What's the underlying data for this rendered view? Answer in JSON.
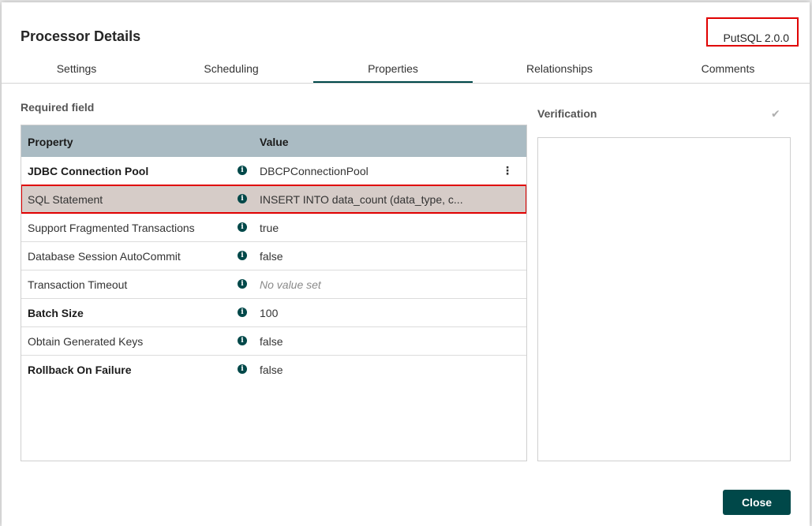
{
  "dialog": {
    "title": "Processor Details",
    "version": "PutSQL 2.0.0"
  },
  "tabs": [
    {
      "label": "Settings"
    },
    {
      "label": "Scheduling"
    },
    {
      "label": "Properties",
      "active": true
    },
    {
      "label": "Relationships"
    },
    {
      "label": "Comments"
    }
  ],
  "properties": {
    "required_label": "Required field",
    "headers": {
      "property": "Property",
      "value": "Value"
    },
    "rows": [
      {
        "name": "JDBC Connection Pool",
        "value": "DBCPConnectionPool",
        "bold": true
      },
      {
        "name": "SQL Statement",
        "value": "INSERT INTO data_count (data_type, c...",
        "selected": true
      },
      {
        "name": "Support Fragmented Transactions",
        "value": "true"
      },
      {
        "name": "Database Session AutoCommit",
        "value": "false"
      },
      {
        "name": "Transaction Timeout",
        "value": "No value set",
        "empty": true
      },
      {
        "name": "Batch Size",
        "value": "100",
        "bold": true
      },
      {
        "name": "Obtain Generated Keys",
        "value": "false"
      },
      {
        "name": "Rollback On Failure",
        "value": "false",
        "bold": true
      }
    ]
  },
  "verification": {
    "label": "Verification",
    "icon": "check-icon"
  },
  "footer": {
    "close_label": "Close"
  },
  "colors": {
    "accent": "#004849",
    "header_bg": "#aabbc3",
    "selected_row": "#d6ccc8",
    "highlight": "#e00000"
  }
}
